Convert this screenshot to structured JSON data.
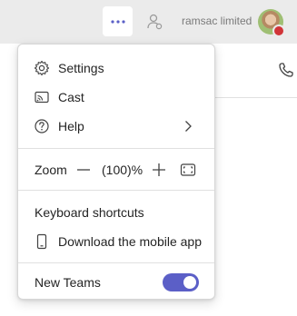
{
  "header": {
    "org_name": "ramsac limited",
    "presence_color": "#d13438",
    "more_icon": "more-horizontal-icon",
    "people_icon": "person-icon",
    "call_icon": "phone-icon"
  },
  "menu": {
    "items": [
      {
        "label": "Settings",
        "icon": "gear-icon"
      },
      {
        "label": "Cast",
        "icon": "cast-icon"
      },
      {
        "label": "Help",
        "icon": "help-icon",
        "has_submenu": true
      }
    ],
    "zoom": {
      "label": "Zoom",
      "value": "(100)%"
    },
    "keyboard_shortcuts": "Keyboard shortcuts",
    "download_app": {
      "label": "Download the mobile app",
      "icon": "phone-device-icon"
    },
    "new_teams": {
      "label": "New Teams",
      "enabled": true,
      "accent": "#5b5fc7"
    }
  }
}
